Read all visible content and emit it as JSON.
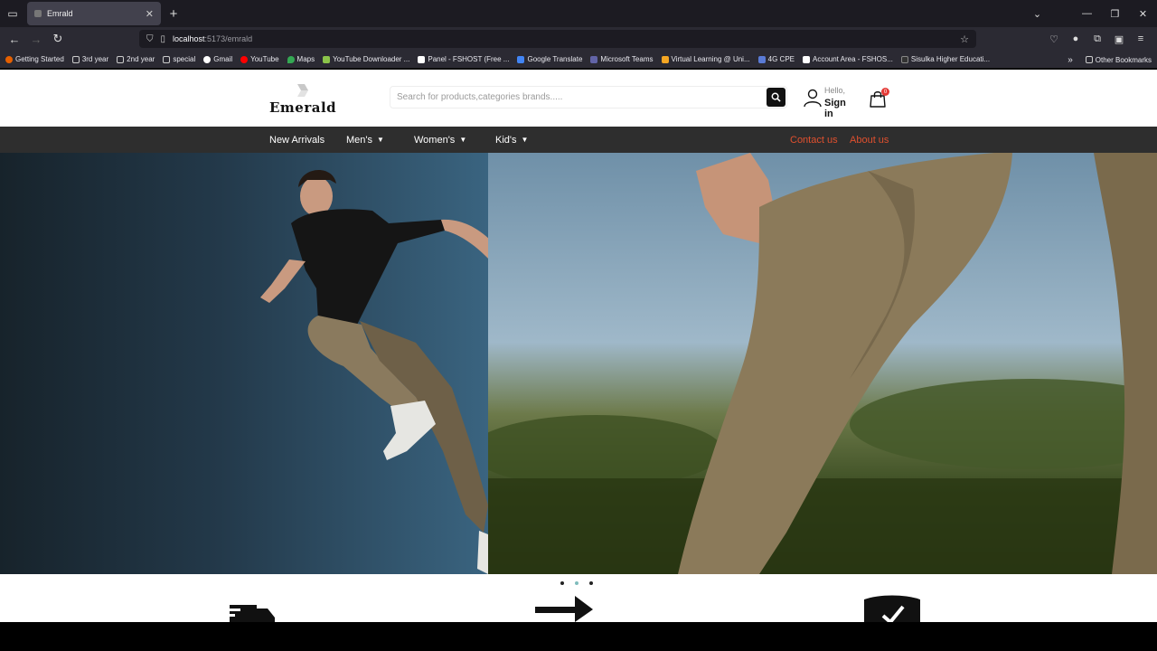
{
  "browser": {
    "tab_title": "Emrald",
    "url_host": "localhost",
    "url_path": ":5173/emrald",
    "bookmarks": [
      {
        "label": "Getting Started",
        "color": "#e66000"
      },
      {
        "label": "3rd year",
        "color": "folder"
      },
      {
        "label": "2nd year",
        "color": "folder"
      },
      {
        "label": "special",
        "color": "folder"
      },
      {
        "label": "Gmail",
        "color": "#ffffff"
      },
      {
        "label": "YouTube",
        "color": "#ff0000"
      },
      {
        "label": "Maps",
        "color": "#34a853"
      },
      {
        "label": "YouTube Downloader ...",
        "color": "#8bc34a"
      },
      {
        "label": "Panel - FSHOST (Free ...",
        "color": "#ffffff"
      },
      {
        "label": "Google Translate",
        "color": "#4285f4"
      },
      {
        "label": "Microsoft Teams",
        "color": "#6264a7"
      },
      {
        "label": "Virtual Learning @ Uni...",
        "color": "#f5a623"
      },
      {
        "label": "4G CPE",
        "color": "#5a7bd6"
      },
      {
        "label": "Account Area - FSHOS...",
        "color": "#ffffff"
      },
      {
        "label": "Sisulka Higher Educati...",
        "color": "#333333"
      }
    ],
    "other_bookmarks": "Other Bookmarks"
  },
  "site": {
    "logo_text": "Emerald",
    "search_placeholder": "Search for products,categories brands.....",
    "account": {
      "hello": "Hello,",
      "signin": "Sign in"
    },
    "cart_count": "0",
    "menu": {
      "new_arrivals": "New Arrivals",
      "mens": "Men's",
      "womens": "Women's",
      "kids": "Kid's",
      "contact": "Contact us",
      "about": "About us"
    },
    "carousel": {
      "slides": 3,
      "active_index": 1
    },
    "colors": {
      "accent": "#e0502e",
      "menu_bg": "#2e2e2e",
      "dot_active": "#7fbcbc"
    }
  }
}
